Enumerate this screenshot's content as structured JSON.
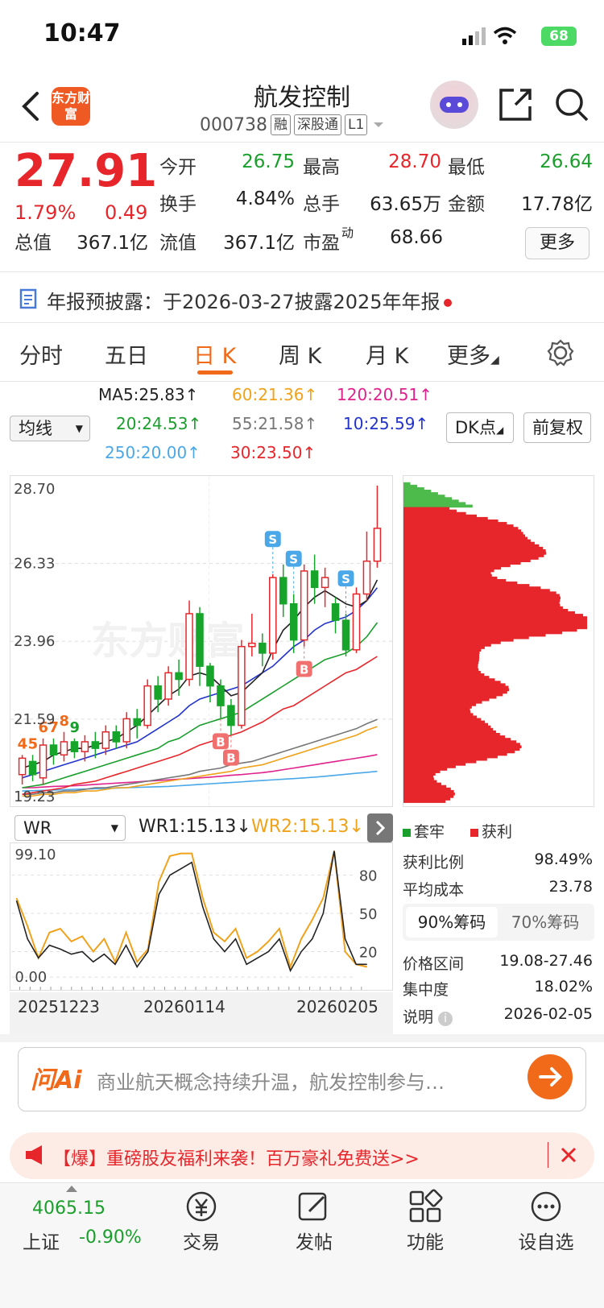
{
  "status": {
    "time": "10:47",
    "battery": "68"
  },
  "header": {
    "title": "航发控制",
    "code": "000738",
    "tags": [
      "融",
      "深股通",
      "L1"
    ],
    "logo": "东方财富"
  },
  "quote": {
    "price": "27.91",
    "pct": "1.79%",
    "chg": "0.49",
    "rows": [
      [
        {
          "l": "今开",
          "v": "26.75",
          "c": "green"
        },
        {
          "l": "最高",
          "v": "28.70",
          "c": "red"
        },
        {
          "l": "最低",
          "v": "26.64",
          "c": "green"
        }
      ],
      [
        {
          "l": "换手",
          "v": "4.84%",
          "c": "blk"
        },
        {
          "l": "总手",
          "v": "63.65万",
          "c": "blk"
        },
        {
          "l": "金额",
          "v": "17.78亿",
          "c": "blk"
        }
      ],
      [
        {
          "l": "总值",
          "v": "367.1亿",
          "c": "blk"
        },
        {
          "l": "流值",
          "v": "367.1亿",
          "c": "blk"
        },
        {
          "l": "市盈",
          "v": "68.66",
          "c": "blk",
          "sup": "动"
        }
      ]
    ],
    "more": "更多"
  },
  "notice": "年报预披露：于2026-03-27披露2025年年报",
  "tabs": [
    "分时",
    "五日",
    "日 K",
    "周 K",
    "月 K",
    "更多"
  ],
  "active_tab": 2,
  "ma": {
    "select": "均线",
    "items": [
      {
        "t": "MA5:25.83",
        "a": "↑",
        "color": "#222222"
      },
      {
        "t": "60:21.36",
        "a": "↑",
        "color": "#f0a21a"
      },
      {
        "t": "120:20.51",
        "a": "↑",
        "color": "#e0228c"
      },
      {
        "t": "20:24.53",
        "a": "↑",
        "color": "#1a9e2c"
      },
      {
        "t": "55:21.58",
        "a": "↑",
        "color": "#777777"
      },
      {
        "t": "10:25.59",
        "a": "↑",
        "color": "#2233cc"
      },
      {
        "t": "250:20.00",
        "a": "↑",
        "color": "#4aa8e8"
      },
      {
        "t": "30:23.50",
        "a": "↑",
        "color": "#e6262b"
      }
    ],
    "dk": "DK点",
    "fq": "前复权"
  },
  "kchart": {
    "y_labels": [
      "28.70",
      "26.33",
      "23.96",
      "21.59",
      "19.23"
    ],
    "ymin": 19.23,
    "ymax": 28.7,
    "candles": [
      [
        19.9,
        20.4,
        19.6,
        20.5
      ],
      [
        20.3,
        19.9,
        19.7,
        20.5
      ],
      [
        19.8,
        20.8,
        19.6,
        21.0
      ],
      [
        20.8,
        20.5,
        20.2,
        21.0
      ],
      [
        20.5,
        20.9,
        20.3,
        21.2
      ],
      [
        20.9,
        20.6,
        20.4,
        21.0
      ],
      [
        20.6,
        20.9,
        20.3,
        21.1
      ],
      [
        20.9,
        20.7,
        20.4,
        21.2
      ],
      [
        20.7,
        21.2,
        20.5,
        21.4
      ],
      [
        21.2,
        20.9,
        20.7,
        21.4
      ],
      [
        20.9,
        21.6,
        20.7,
        21.8
      ],
      [
        21.6,
        21.4,
        21.0,
        21.9
      ],
      [
        21.4,
        22.6,
        21.3,
        22.8
      ],
      [
        22.6,
        22.2,
        21.8,
        22.9
      ],
      [
        22.2,
        23.0,
        22.0,
        23.2
      ],
      [
        23.0,
        22.8,
        22.3,
        23.4
      ],
      [
        22.8,
        24.8,
        22.6,
        25.2
      ],
      [
        24.8,
        23.2,
        22.6,
        25.0
      ],
      [
        23.2,
        22.6,
        22.1,
        23.3
      ],
      [
        22.6,
        22.0,
        21.6,
        22.8
      ],
      [
        22.0,
        21.4,
        21.1,
        22.2
      ],
      [
        21.4,
        23.8,
        21.3,
        24.0
      ],
      [
        23.8,
        23.9,
        23.5,
        24.8
      ],
      [
        23.9,
        23.6,
        23.2,
        24.2
      ],
      [
        23.6,
        25.9,
        23.4,
        26.0
      ],
      [
        25.9,
        25.1,
        24.7,
        26.3
      ],
      [
        25.1,
        24.0,
        23.6,
        25.4
      ],
      [
        24.0,
        26.1,
        23.8,
        26.3
      ],
      [
        26.1,
        25.6,
        25.1,
        26.6
      ],
      [
        25.6,
        25.9,
        25.0,
        26.2
      ],
      [
        25.1,
        24.6,
        24.2,
        25.3
      ],
      [
        24.6,
        23.7,
        23.5,
        24.8
      ],
      [
        23.7,
        25.4,
        23.6,
        25.6
      ],
      [
        25.4,
        26.4,
        25.2,
        27.3
      ],
      [
        26.4,
        27.4,
        26.2,
        28.7
      ]
    ],
    "ma5": [
      20.1,
      20.2,
      20.3,
      20.5,
      20.6,
      20.7,
      20.7,
      20.8,
      20.9,
      21.0,
      21.2,
      21.4,
      21.7,
      22.0,
      22.3,
      22.5,
      22.9,
      23.0,
      22.9,
      22.6,
      22.3,
      22.4,
      22.7,
      23.0,
      23.7,
      24.3,
      24.6,
      25.0,
      25.3,
      25.5,
      25.3,
      25.1,
      25.0,
      25.2,
      25.83
    ],
    "ma10": [
      19.8,
      19.9,
      20.0,
      20.1,
      20.2,
      20.3,
      20.4,
      20.5,
      20.6,
      20.7,
      20.8,
      20.9,
      21.1,
      21.3,
      21.5,
      21.7,
      22.0,
      22.2,
      22.3,
      22.4,
      22.5,
      22.6,
      22.8,
      23.0,
      23.2,
      23.5,
      23.8,
      24.0,
      24.3,
      24.5,
      24.6,
      24.7,
      24.9,
      25.2,
      25.59
    ],
    "ma20": [
      19.5,
      19.55,
      19.6,
      19.7,
      19.8,
      19.9,
      20.0,
      20.1,
      20.2,
      20.3,
      20.4,
      20.5,
      20.6,
      20.7,
      20.9,
      21.0,
      21.2,
      21.4,
      21.5,
      21.6,
      21.7,
      21.8,
      22.0,
      22.2,
      22.4,
      22.6,
      22.8,
      23.0,
      23.2,
      23.4,
      23.5,
      23.6,
      23.8,
      24.1,
      24.53
    ],
    "ma30": [
      19.3,
      19.35,
      19.4,
      19.45,
      19.5,
      19.6,
      19.65,
      19.7,
      19.8,
      19.9,
      20.0,
      20.1,
      20.2,
      20.3,
      20.4,
      20.5,
      20.65,
      20.8,
      20.9,
      21.0,
      21.1,
      21.2,
      21.35,
      21.5,
      21.7,
      21.9,
      22.0,
      22.2,
      22.4,
      22.6,
      22.8,
      23.0,
      23.1,
      23.3,
      23.5
    ],
    "ma55": [
      19.3,
      19.3,
      19.35,
      19.35,
      19.4,
      19.4,
      19.45,
      19.5,
      19.5,
      19.55,
      19.6,
      19.65,
      19.7,
      19.75,
      19.8,
      19.85,
      19.9,
      20.0,
      20.05,
      20.1,
      20.2,
      20.25,
      20.3,
      20.4,
      20.5,
      20.6,
      20.7,
      20.8,
      20.9,
      21.0,
      21.1,
      21.2,
      21.3,
      21.45,
      21.58
    ],
    "ma60": [
      19.25,
      19.25,
      19.3,
      19.3,
      19.35,
      19.35,
      19.4,
      19.4,
      19.45,
      19.5,
      19.5,
      19.55,
      19.6,
      19.65,
      19.7,
      19.75,
      19.8,
      19.85,
      19.9,
      19.95,
      20.0,
      20.1,
      20.15,
      20.2,
      20.3,
      20.4,
      20.5,
      20.6,
      20.7,
      20.8,
      20.9,
      21.0,
      21.1,
      21.25,
      21.36
    ],
    "ma120": [
      19.5,
      19.5,
      19.52,
      19.54,
      19.55,
      19.56,
      19.58,
      19.6,
      19.62,
      19.64,
      19.66,
      19.68,
      19.7,
      19.72,
      19.74,
      19.76,
      19.78,
      19.8,
      19.82,
      19.85,
      19.88,
      19.9,
      19.93,
      19.96,
      20.0,
      20.05,
      20.1,
      20.15,
      20.2,
      20.25,
      20.3,
      20.35,
      20.4,
      20.45,
      20.51
    ],
    "ma250": [
      19.4,
      19.41,
      19.42,
      19.43,
      19.44,
      19.45,
      19.46,
      19.47,
      19.48,
      19.49,
      19.5,
      19.51,
      19.52,
      19.53,
      19.54,
      19.56,
      19.58,
      19.6,
      19.62,
      19.64,
      19.66,
      19.68,
      19.7,
      19.72,
      19.74,
      19.76,
      19.78,
      19.8,
      19.82,
      19.85,
      19.88,
      19.91,
      19.94,
      19.97,
      20.0
    ],
    "markers": [
      {
        "i": 0,
        "t": "4",
        "c": "#f06a1a"
      },
      {
        "i": 1,
        "t": "5",
        "c": "#f06a1a"
      },
      {
        "i": 2,
        "t": "6",
        "c": "#f06a1a"
      },
      {
        "i": 3,
        "t": "7",
        "c": "#f06a1a"
      },
      {
        "i": 4,
        "t": "8",
        "c": "#f06a1a"
      },
      {
        "i": 5,
        "t": "9",
        "c": "#1a9e2c"
      }
    ],
    "bs": [
      {
        "i": 19,
        "t": "B",
        "c": "#f07070"
      },
      {
        "i": 20,
        "t": "B",
        "c": "#f07070"
      },
      {
        "i": 24,
        "t": "S",
        "c": "#4aa8e8"
      },
      {
        "i": 26,
        "t": "S",
        "c": "#4aa8e8"
      },
      {
        "i": 27,
        "t": "B",
        "c": "#f07070"
      },
      {
        "i": 31,
        "t": "S",
        "c": "#4aa8e8"
      }
    ],
    "watermark": "东方财富"
  },
  "wr": {
    "select": "WR",
    "wr1": "WR1:15.13",
    "wr1_arrow": "↓",
    "wr2": "WR2:15.13",
    "wr2_arrow": "↓",
    "top_label": "99.10",
    "bottom_label": "0.00",
    "levels": [
      "80",
      "50",
      "20"
    ],
    "wr1_vals": [
      60,
      30,
      15,
      25,
      22,
      18,
      20,
      12,
      18,
      10,
      25,
      8,
      20,
      65,
      80,
      85,
      90,
      55,
      30,
      20,
      30,
      10,
      15,
      20,
      30,
      5,
      20,
      30,
      50,
      99,
      30,
      10,
      10
    ],
    "wr2_vals": [
      62,
      40,
      15,
      35,
      38,
      28,
      32,
      20,
      30,
      12,
      35,
      12,
      22,
      75,
      95,
      97,
      97,
      62,
      35,
      28,
      38,
      15,
      20,
      28,
      38,
      8,
      30,
      45,
      62,
      99,
      20,
      10,
      8
    ],
    "dates": [
      "20251223",
      "20260114",
      "20260205"
    ]
  },
  "chip": {
    "legend": [
      {
        "t": "套牢",
        "c": "#1a9e2c"
      },
      {
        "t": "获利",
        "c": "#e6262b"
      }
    ],
    "profit_ratio_label": "获利比例",
    "profit_ratio": "98.49%",
    "avg_cost_label": "平均成本",
    "avg_cost": "23.78",
    "tabs": [
      "90%筹码",
      "70%筹码"
    ],
    "range_label": "价格区间",
    "range": "19.08-27.46",
    "conc_label": "集中度",
    "conc": "18.02%",
    "note_label": "说明",
    "note_date": "2026-02-05"
  },
  "ai": {
    "logo": "问Ai",
    "text": "商业航天概念持续升温，航发控制参与…"
  },
  "promo": {
    "text": "【爆】重磅股友福利来袭！百万豪礼免费送>>"
  },
  "bottom_nav": {
    "index_value": "4065.15",
    "index_name": "上证",
    "index_pct": "-0.90%",
    "items": [
      "交易",
      "发帖",
      "功能",
      "设自选"
    ]
  }
}
